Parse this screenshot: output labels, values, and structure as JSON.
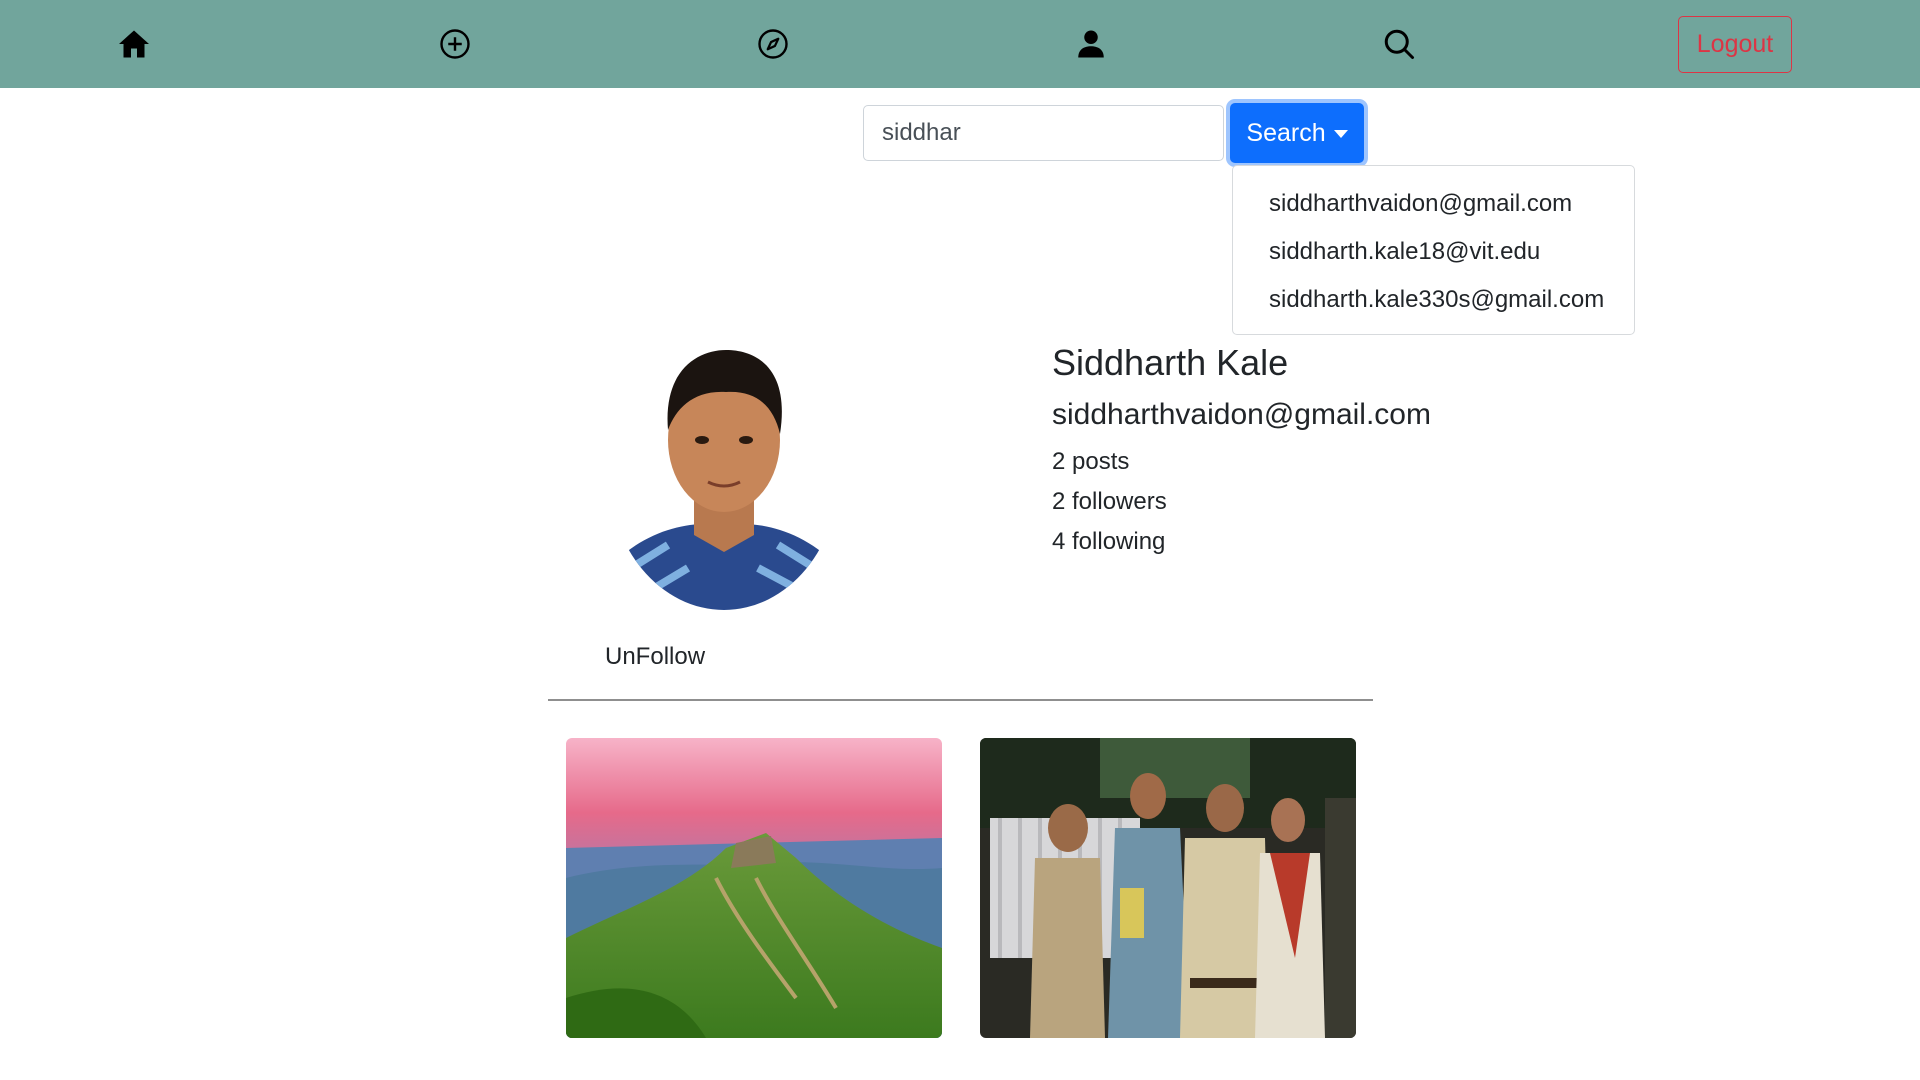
{
  "nav": {
    "icons": [
      "home-icon",
      "add-circle-icon",
      "compass-icon",
      "person-icon",
      "search-icon"
    ],
    "logout_label": "Logout"
  },
  "search": {
    "value": "siddhar",
    "button_label": "Search",
    "results": [
      "siddharthvaidon@gmail.com",
      "siddharth.kale18@vit.edu",
      "siddharth.kale330s@gmail.com"
    ]
  },
  "profile": {
    "name": "Siddharth Kale",
    "email": "siddharthvaidon@gmail.com",
    "posts": "2 posts",
    "followers": "2 followers",
    "following": "4 following",
    "unfollow_label": "UnFollow"
  },
  "colors": {
    "navbar": "#71a59c",
    "search_button": "#0d6efd",
    "logout": "#dc3545"
  }
}
